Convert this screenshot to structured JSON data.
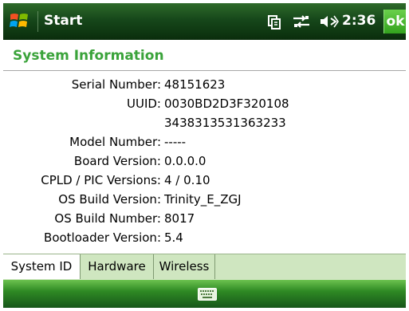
{
  "titlebar": {
    "title": "Start",
    "time": "2:36",
    "ok_label": "ok",
    "icons": [
      "start-flag-icon",
      "connectivity-icon",
      "data-sync-icon",
      "volume-icon"
    ]
  },
  "page": {
    "title": "System Information"
  },
  "info": {
    "rows": [
      {
        "label": "Serial Number:",
        "value": "48151623"
      },
      {
        "label": "UUID:",
        "value": "0030BD2D3F320108"
      },
      {
        "label": "",
        "value": "3438313531363233"
      },
      {
        "label": "Model Number:",
        "value": "-----"
      },
      {
        "label": "Board Version:",
        "value": "0.0.0.0"
      },
      {
        "label": "CPLD / PIC Versions:",
        "value": "4 / 0.10"
      },
      {
        "label": "OS Build Version:",
        "value": "Trinity_E_ZGJ"
      },
      {
        "label": "OS Build Number:",
        "value": "8017"
      },
      {
        "label": "Bootloader Version:",
        "value": "5.4"
      }
    ]
  },
  "tabs": [
    {
      "label": "System ID",
      "active": true
    },
    {
      "label": "Hardware",
      "active": false
    },
    {
      "label": "Wireless",
      "active": false
    }
  ],
  "bottombar": {
    "icons": [
      "keyboard-icon"
    ]
  },
  "colors": {
    "title_green": "#3aa33a",
    "titlebar_dark": "#16471a",
    "ok_green": "#33a21e",
    "tabbar_bg": "#cfe6c0"
  }
}
